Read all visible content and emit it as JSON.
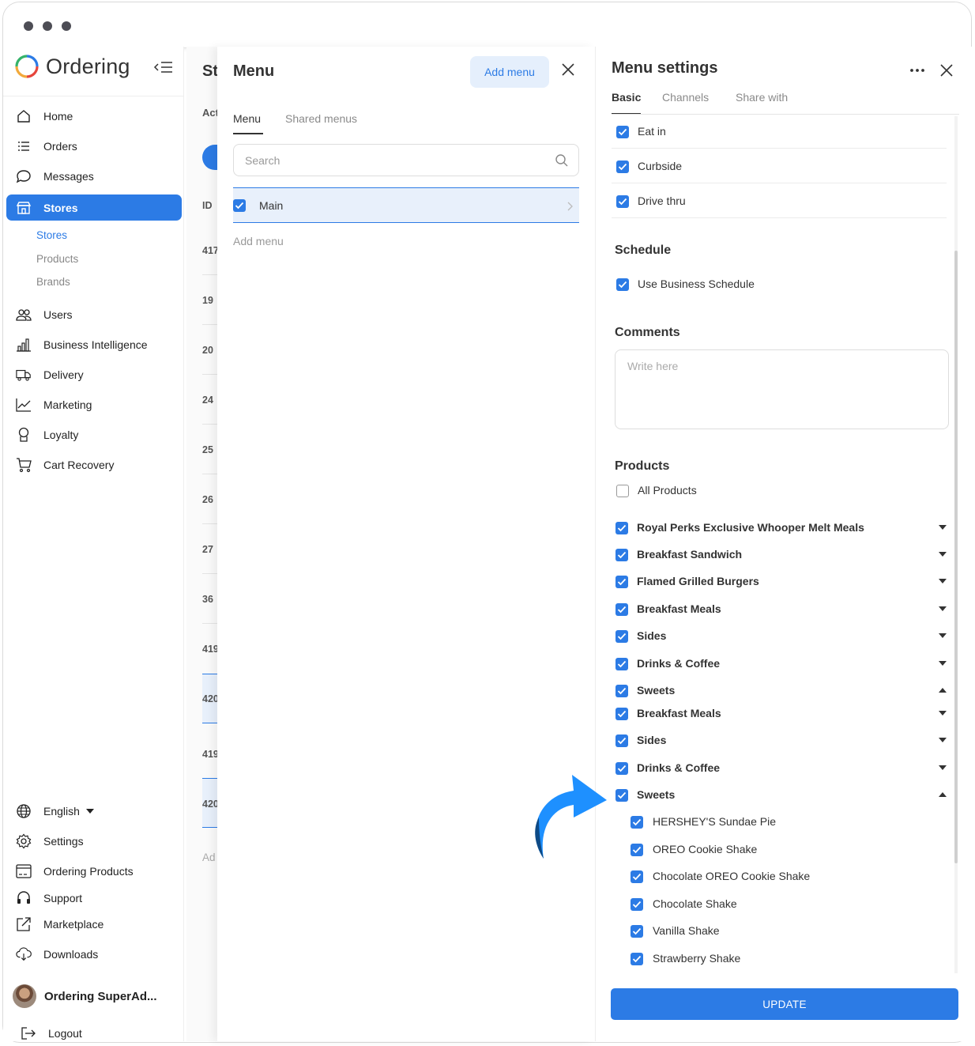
{
  "app": {
    "name": "Ordering"
  },
  "sidebar": {
    "items": [
      {
        "label": "Home",
        "icon": "home-icon"
      },
      {
        "label": "Orders",
        "icon": "list-icon"
      },
      {
        "label": "Messages",
        "icon": "chat-icon"
      },
      {
        "label": "Stores",
        "icon": "store-icon",
        "active": true
      }
    ],
    "sub_items": [
      {
        "label": "Stores",
        "active": true
      },
      {
        "label": "Products"
      },
      {
        "label": "Brands"
      }
    ],
    "items2": [
      {
        "label": "Users",
        "icon": "users-icon"
      },
      {
        "label": "Business Intelligence",
        "icon": "bar-chart-icon"
      },
      {
        "label": "Delivery",
        "icon": "truck-icon"
      },
      {
        "label": "Marketing",
        "icon": "line-chart-icon"
      },
      {
        "label": "Loyalty",
        "icon": "award-icon"
      },
      {
        "label": "Cart Recovery",
        "icon": "cart-icon"
      }
    ],
    "bottom": [
      {
        "label": "English",
        "icon": "globe-icon"
      },
      {
        "label": "Settings",
        "icon": "gear-icon"
      },
      {
        "label": "Ordering Products",
        "icon": "window-icon"
      },
      {
        "label": "Support",
        "icon": "headset-icon"
      },
      {
        "label": "Marketplace",
        "icon": "external-link-icon"
      },
      {
        "label": "Downloads",
        "icon": "cloud-download-icon"
      }
    ],
    "profile_name": "Ordering SuperAd...",
    "logout": "Logout"
  },
  "background_list": {
    "header_fragment": "St",
    "tab_fragment": "Act",
    "id_header": "ID",
    "ids": [
      "417",
      "19",
      "20",
      "24",
      "25",
      "26",
      "27",
      "36",
      "419",
      "420",
      "419",
      "420"
    ],
    "footer_fragment": "Ad"
  },
  "menu_panel": {
    "title": "Menu",
    "add_button": "Add menu",
    "tabs": [
      "Menu",
      "Shared menus"
    ],
    "search_placeholder": "Search",
    "menus": [
      {
        "label": "Main",
        "checked": true
      }
    ],
    "add_link": "Add menu"
  },
  "settings_panel": {
    "title": "Menu settings",
    "tabs": [
      "Basic",
      "Channels",
      "Share with"
    ],
    "order_types": [
      {
        "label": "Eat in",
        "checked": true
      },
      {
        "label": "Curbside",
        "checked": true
      },
      {
        "label": "Drive thru",
        "checked": true
      }
    ],
    "schedule": {
      "heading": "Schedule",
      "option": "Use Business Schedule",
      "checked": true
    },
    "comments": {
      "heading": "Comments",
      "placeholder": "Write here"
    },
    "products": {
      "heading": "Products",
      "all_label": "All Products",
      "all_checked": false,
      "categories": [
        {
          "label": "Royal Perks Exclusive Whooper Melt Meals",
          "expanded": false
        },
        {
          "label": "Breakfast Sandwich",
          "expanded": false
        },
        {
          "label": "Flamed Grilled Burgers",
          "expanded": false
        },
        {
          "label": "Breakfast Meals",
          "expanded": false
        },
        {
          "label": "Sides",
          "expanded": false
        },
        {
          "label": "Drinks & Coffee",
          "expanded": false
        },
        {
          "label": "Sweets",
          "expanded": true
        },
        {
          "label": "Breakfast Meals",
          "expanded": false
        },
        {
          "label": "Sides",
          "expanded": false
        },
        {
          "label": "Drinks & Coffee",
          "expanded": false
        },
        {
          "label": "Sweets",
          "expanded": true
        }
      ],
      "sweets_items": [
        "HERSHEY'S Sundae Pie",
        "OREO Cookie Shake",
        "Chocolate OREO Cookie Shake",
        "Chocolate Shake",
        "Vanilla Shake",
        "Strawberry Shake"
      ]
    },
    "update_button": "UPDATE"
  },
  "colors": {
    "accent": "#2c7be5",
    "accent_light": "#e5effc",
    "arrow": "#1e90ff"
  }
}
